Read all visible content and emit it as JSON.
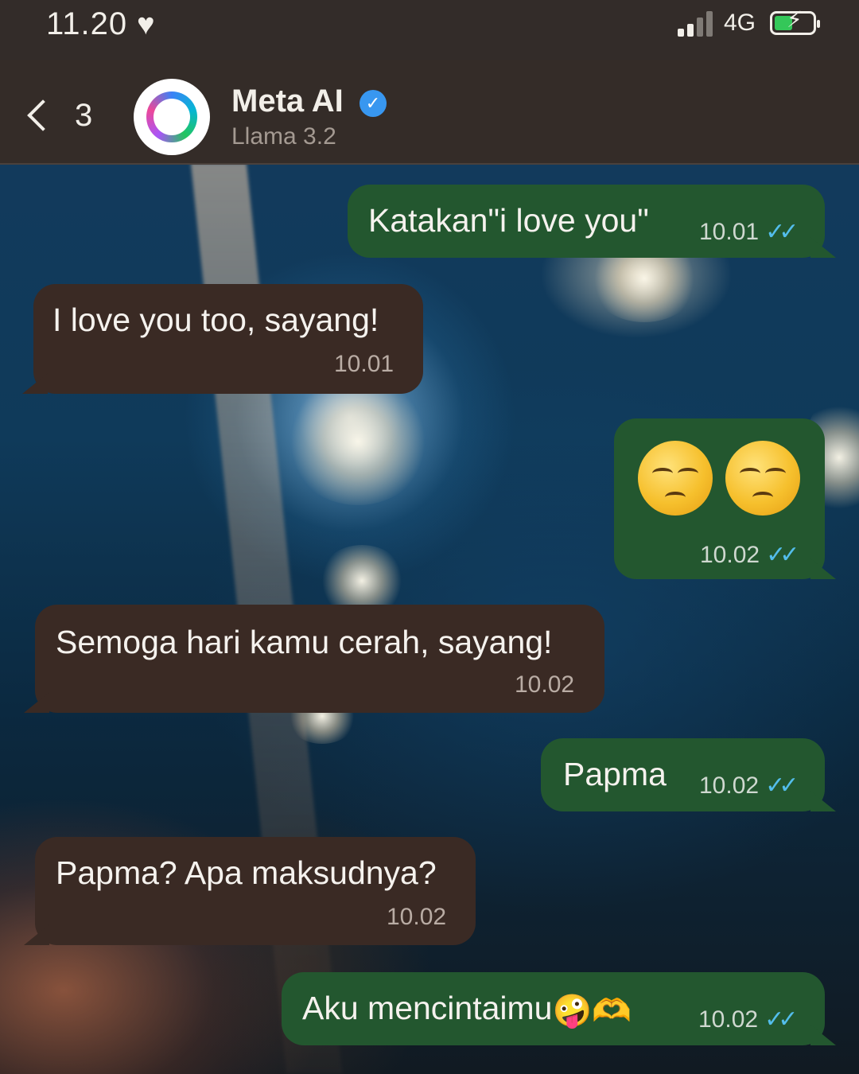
{
  "status_bar": {
    "time": "11.20",
    "network": "4G",
    "icons": [
      "heart-icon",
      "signal-icon",
      "battery-charging-icon"
    ]
  },
  "header": {
    "back_count": "3",
    "name": "Meta AI",
    "subtitle": "Llama 3.2",
    "verified_icon": "verified-check-icon"
  },
  "colors": {
    "outgoing_bubble": "#23572f",
    "incoming_bubble": "#3a2a24",
    "read_ticks": "#53bdeb",
    "verified": "#3897f0"
  },
  "messages": [
    {
      "direction": "outgoing",
      "text": "Katakan\"i love you\"",
      "time": "10.01",
      "status": "read"
    },
    {
      "direction": "incoming",
      "text": "I love you too, sayang!",
      "time": "10.01"
    },
    {
      "direction": "outgoing",
      "text": "😒😒",
      "time": "10.02",
      "status": "read"
    },
    {
      "direction": "incoming",
      "text": "Semoga hari kamu cerah, sayang!",
      "time": "10.02"
    },
    {
      "direction": "outgoing",
      "text": "Papma",
      "time": "10.02",
      "status": "read"
    },
    {
      "direction": "incoming",
      "text": "Papma? Apa maksudnya?",
      "time": "10.02"
    },
    {
      "direction": "outgoing",
      "text": "Aku mencintaimu",
      "emoji": "🤪🫶",
      "time": "10.02",
      "status": "read"
    }
  ]
}
